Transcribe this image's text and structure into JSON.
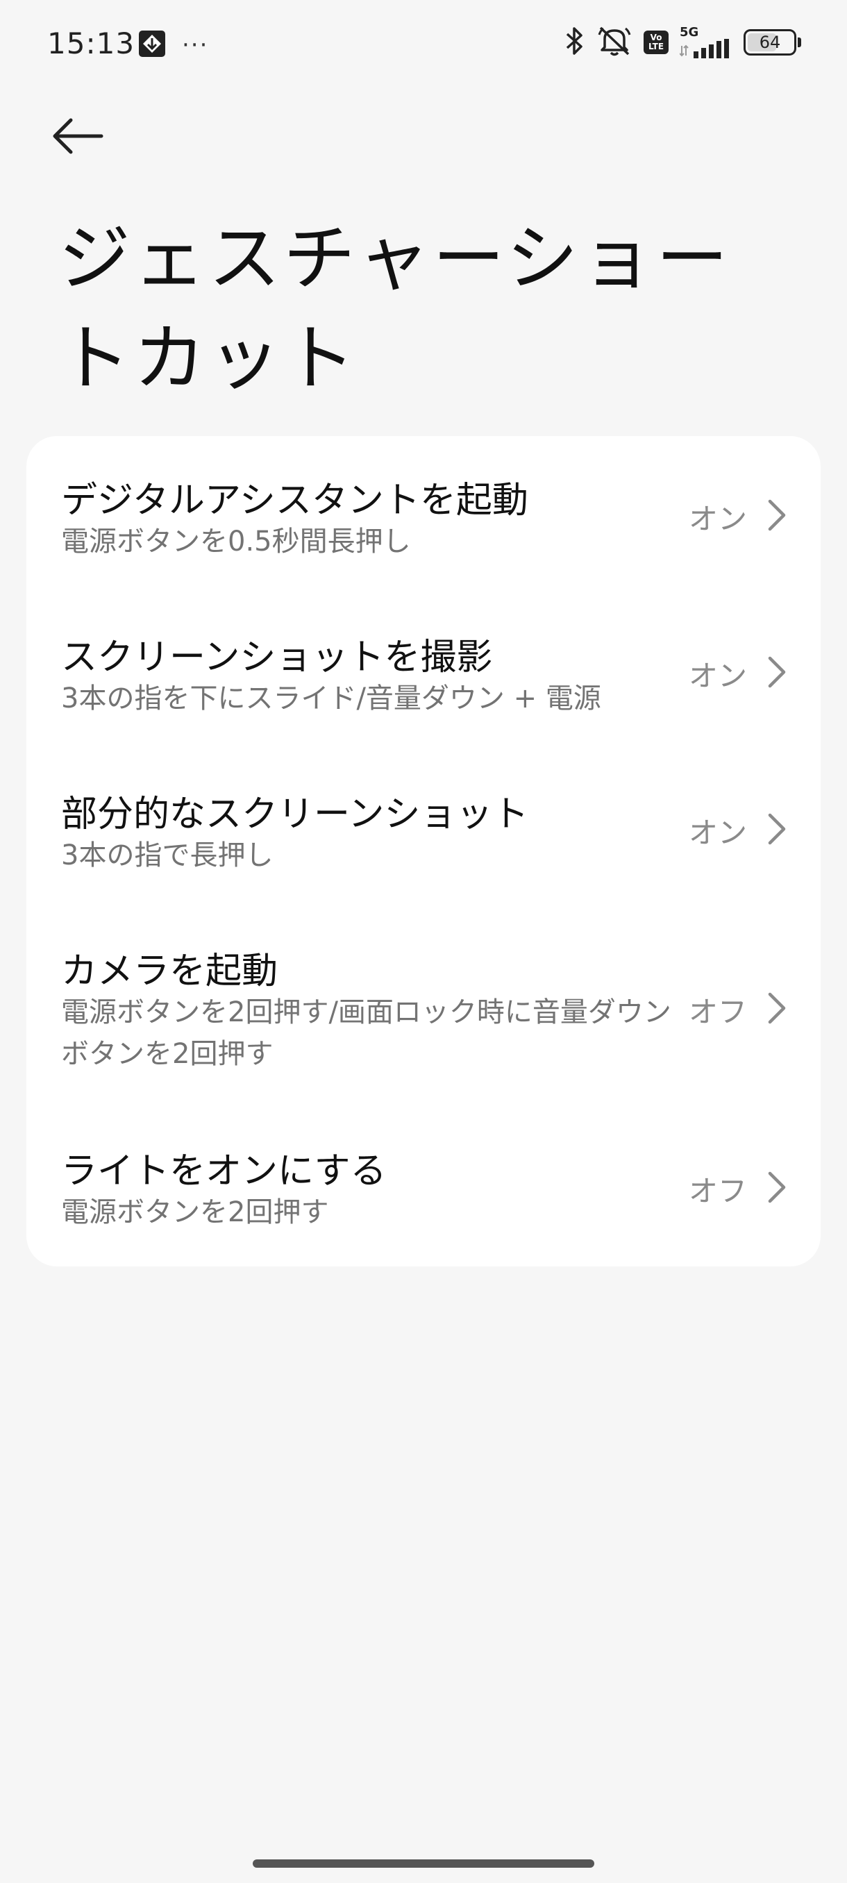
{
  "status_bar": {
    "time": "15:13",
    "more": "···",
    "volte_top": "Vo",
    "volte_bottom": "LTE",
    "network": "5G",
    "battery": "64",
    "battery_level": 0.64,
    "icons": [
      "photo-icon",
      "more-dots-icon",
      "bluetooth-icon",
      "mute-icon",
      "volte-icon",
      "signal-5g-icon",
      "battery-icon"
    ]
  },
  "header": {
    "back_icon": "arrow-left-icon",
    "title": "ジェスチャーショートカット"
  },
  "gestures": [
    {
      "title": "デジタルアシスタントを起動",
      "subtitle": "電源ボタンを0.5秒間長押し",
      "value": "オン"
    },
    {
      "title": "スクリーンショットを撮影",
      "subtitle": "3本の指を下にスライド/音量ダウン + 電源",
      "value": "オン"
    },
    {
      "title": "部分的なスクリーンショット",
      "subtitle": "3本の指で長押し",
      "value": "オン"
    },
    {
      "title": "カメラを起動",
      "subtitle": "電源ボタンを2回押す/画面ロック時に音量ダウンボタンを2回押す",
      "value": "オフ"
    },
    {
      "title": "ライトをオンにする",
      "subtitle": "電源ボタンを2回押す",
      "value": "オフ"
    }
  ],
  "colors": {
    "background": "#f6f6f6",
    "card": "#ffffff",
    "secondary_text": "#737373",
    "value_text": "#8a8a8a"
  }
}
